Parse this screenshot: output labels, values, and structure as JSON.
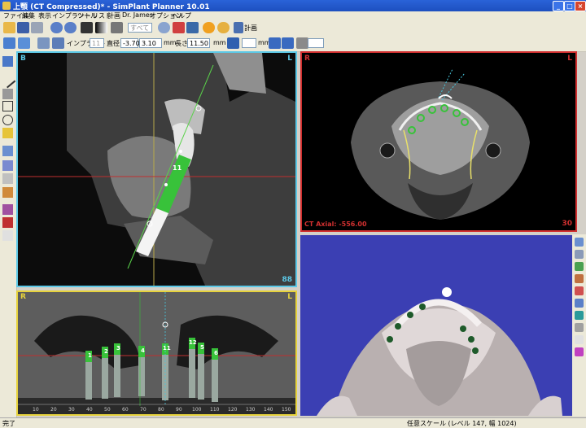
{
  "window": {
    "title": "上顎 (CT Compressed)* - SimPlant Planner 10.01",
    "minimize": "_",
    "maximize": "□",
    "close": "×"
  },
  "menu": [
    "ファイル",
    "編集",
    "表示",
    "インプラント",
    "ツール",
    "リスト",
    "計画",
    "Dr. James",
    "オプション",
    "ヘルプ"
  ],
  "toolbar1": {
    "plan_label": "計画",
    "dropdown_label": "すべて"
  },
  "toolbar2": {
    "implant_label": "インプラント",
    "implant_value": "11",
    "diameter_label": "直径:",
    "diameter_value": "-3.70",
    "diameter_value2": "3.10",
    "diameter_unit": "mm",
    "length_label": "長さ:",
    "length_value": "11.50",
    "length_unit": "mm",
    "offset_unit": "mm"
  },
  "panels": {
    "sagittal": {
      "left_label": "B",
      "right_label": "L",
      "slice": "88",
      "implant_number": "11"
    },
    "axial": {
      "left_label": "R",
      "right_label": "L",
      "status": "CT Axial: -556.00",
      "slice": "30"
    },
    "panoramic": {
      "left_label": "R",
      "right_label": "L",
      "implant_numbers": [
        "1",
        "2",
        "3",
        "4",
        "11",
        "12",
        "5",
        "6"
      ],
      "ruler": [
        "10",
        "20",
        "30",
        "40",
        "50",
        "60",
        "70",
        "80",
        "90",
        "100",
        "110",
        "120",
        "130",
        "140",
        "150"
      ]
    },
    "volume": {}
  },
  "status": {
    "left": "完了",
    "right": "任意スケール (レベル 147, 幅 1024)"
  },
  "colors": {
    "sagittal_border": "#5cc8e6",
    "axial_border": "#d23030",
    "panoramic_border": "#e6d23c",
    "volume_bg": "#3b3fb3",
    "implant_green": "#38c23a"
  }
}
